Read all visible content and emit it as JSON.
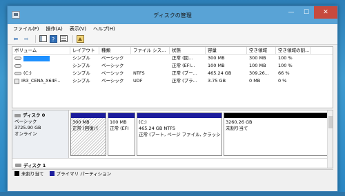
{
  "window": {
    "title": "ディスクの管理",
    "minimize": "—",
    "maximize": "☐",
    "close": "✕"
  },
  "menu": [
    "ファイル(F)",
    "操作(A)",
    "表示(V)",
    "ヘルプ(H)"
  ],
  "columns": [
    "ボリューム",
    "レイアウト",
    "種類",
    "ファイル シス...",
    "状態",
    "容量",
    "空き領域",
    "空き領域の割..."
  ],
  "volumes": [
    {
      "name": "",
      "layout": "シンプル",
      "type": "ベーシック",
      "fs": "",
      "status": "正常 (回...",
      "capacity": "300 MB",
      "free": "300 MB",
      "pct": "100 %"
    },
    {
      "name": "",
      "layout": "シンプル",
      "type": "ベーシック",
      "fs": "",
      "status": "正常 (EFI...",
      "capacity": "100 MB",
      "free": "100 MB",
      "pct": "100 %"
    },
    {
      "name": "(C:)",
      "layout": "シンプル",
      "type": "ベーシック",
      "fs": "NTFS",
      "status": "正常 (ブー...",
      "capacity": "465.24 GB",
      "free": "309.26...",
      "pct": "66 %"
    },
    {
      "name": "IR3_CENA_X64F...",
      "layout": "シンプル",
      "type": "ベーシック",
      "fs": "UDF",
      "status": "正常 (プラ...",
      "capacity": "3.75 GB",
      "free": "0 MB",
      "pct": "0 %"
    }
  ],
  "disk0": {
    "name": "ディスク 0",
    "kind": "ベーシック",
    "size": "3725.90 GB",
    "state": "オンライン",
    "partitions": [
      {
        "title": "",
        "size": "300 MB",
        "status": "正常 (回復パ"
      },
      {
        "title": "",
        "size": "100 MB",
        "status": "正常 (EFI"
      },
      {
        "title": "(C:)",
        "size": "465.24 GB NTFS",
        "status": "正常 (ブート, ページ ファイル, クラッシ"
      },
      {
        "title": "",
        "size": "3260.26 GB",
        "status": "未割り当て"
      }
    ]
  },
  "disk1": {
    "name": "ディスク 1"
  },
  "legend": {
    "unallocated": "未割り当て",
    "primary": "プライマリ パーティション"
  },
  "colors": {
    "primary": "#1c1c9c",
    "unallocated": "#000000",
    "titlebar": "#59a3d6",
    "close": "#c74a3e"
  }
}
